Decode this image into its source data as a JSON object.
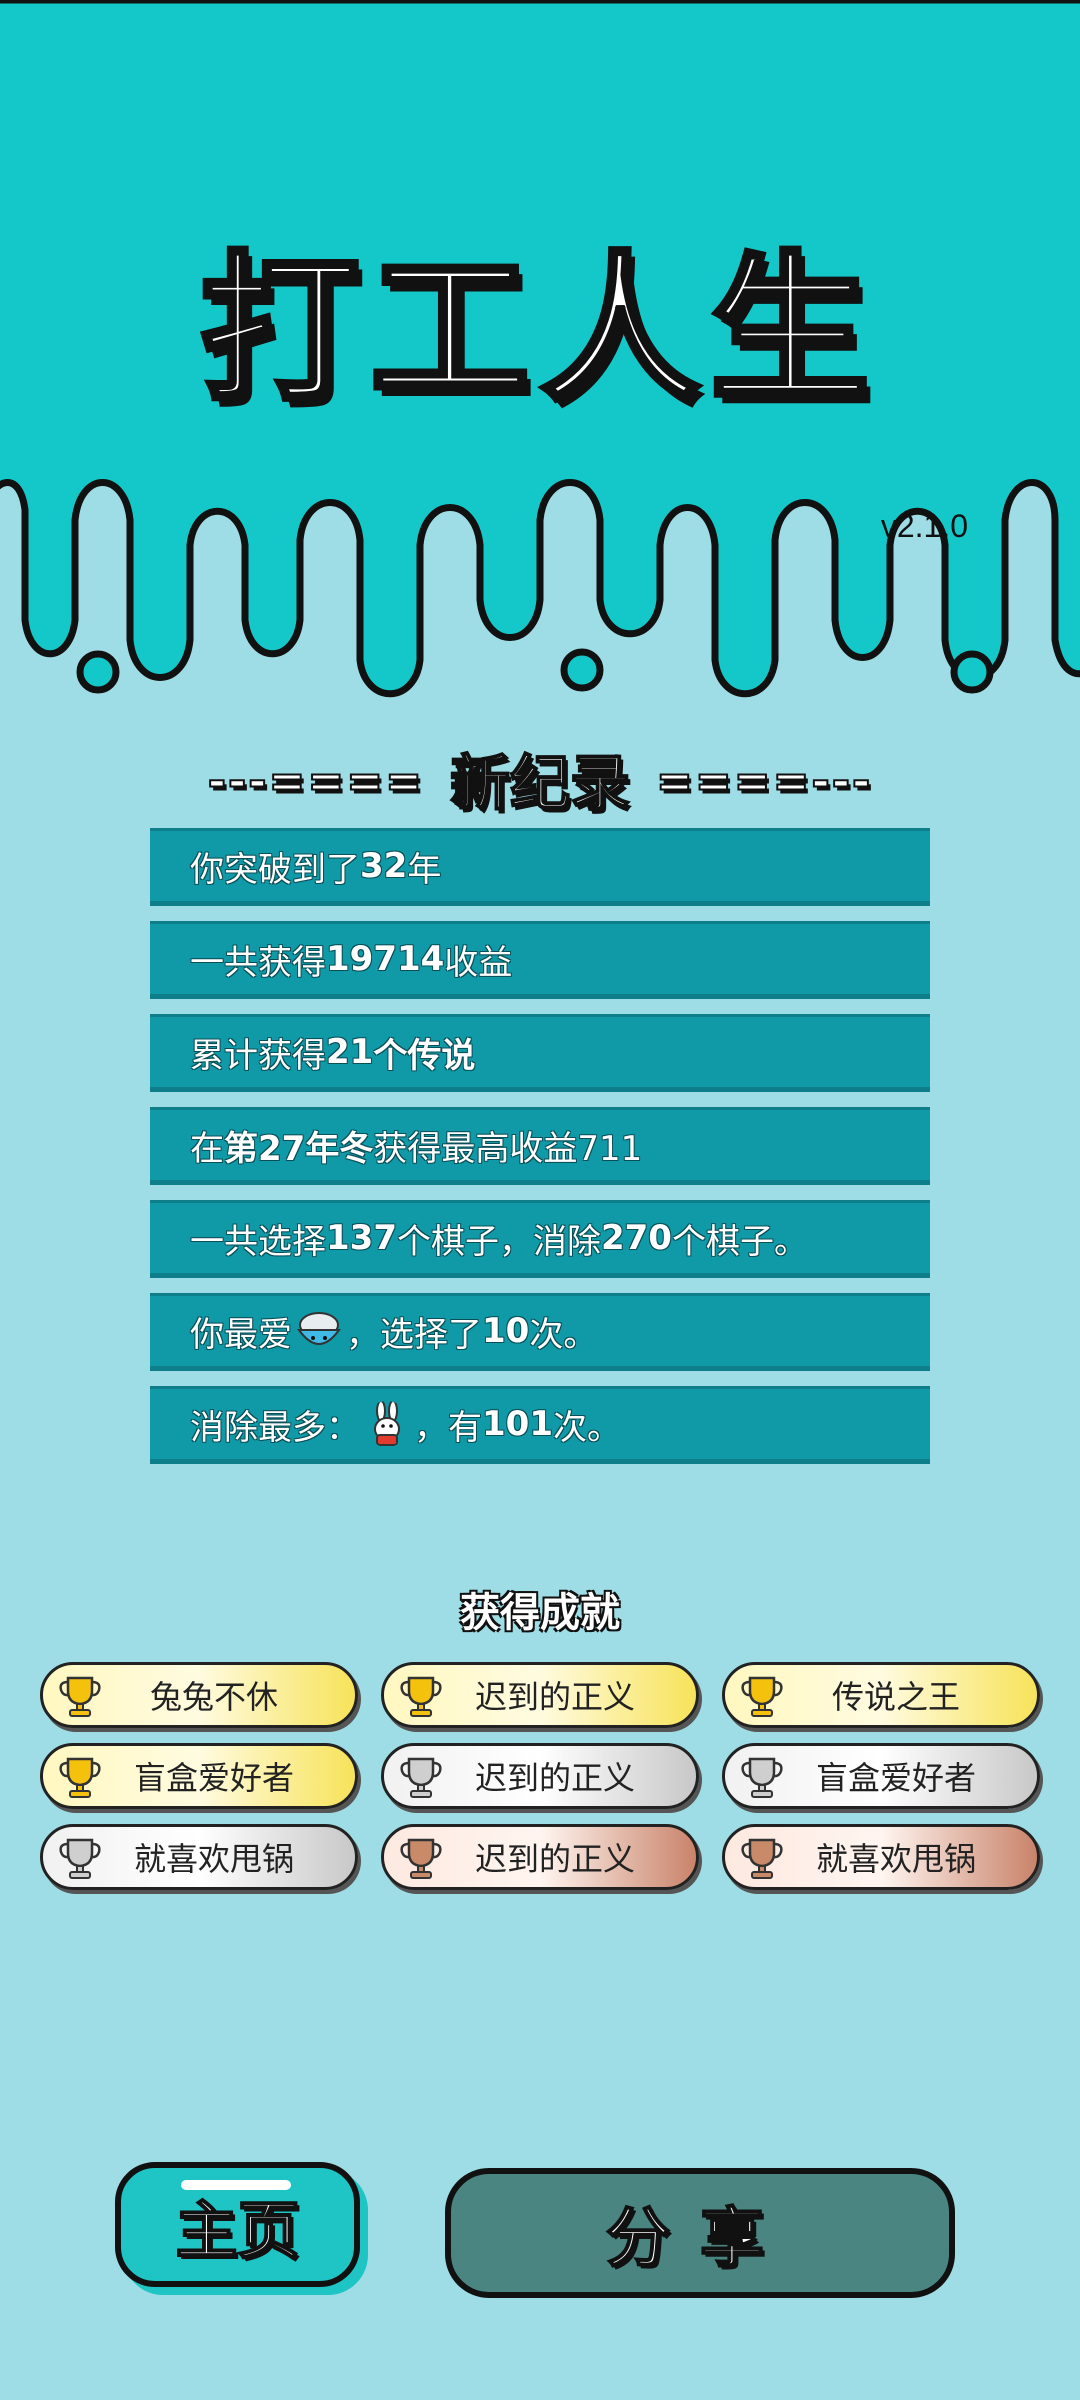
{
  "colors": {
    "header_bg": "#14c8c9",
    "body_bg": "#9fdde6",
    "record_bg": "#109aa8",
    "home_button": "#1fc4c4",
    "share_button": "#4a8582"
  },
  "header": {
    "game_title": "打工人生",
    "version": "v2.1.0"
  },
  "record": {
    "heading_left": "---====",
    "heading": "新纪录",
    "heading_right": "====---",
    "items": [
      {
        "prefix": "你突破到了",
        "value": "32",
        "suffix": "年"
      },
      {
        "prefix": "一共获得",
        "value": "19714",
        "suffix": "收益"
      },
      {
        "prefix": "累计获得",
        "value": "21",
        "suffix": "个传说"
      },
      {
        "prefix": "在 ",
        "value": "第27年冬",
        "suffix": " 获得最高收益711"
      },
      {
        "prefix": "一共选择",
        "value": "137",
        "mid": "个棋子，消除",
        "value2": "270",
        "suffix": "个棋子。"
      },
      {
        "prefix": "你最爱",
        "icon": "rice-bowl-icon",
        "mid": "，选择了",
        "value": "10",
        "suffix": "次。"
      },
      {
        "prefix": "消除最多：",
        "icon": "rabbit-icon",
        "mid": "，有",
        "value": "101",
        "suffix": "次。"
      }
    ]
  },
  "achievements": {
    "title": "获得成就",
    "items": [
      {
        "label": "兔兔不休",
        "tier": "gold"
      },
      {
        "label": "迟到的正义",
        "tier": "gold"
      },
      {
        "label": "传说之王",
        "tier": "gold"
      },
      {
        "label": "盲盒爱好者",
        "tier": "gold"
      },
      {
        "label": "迟到的正义",
        "tier": "silver"
      },
      {
        "label": "盲盒爱好者",
        "tier": "silver"
      },
      {
        "label": "就喜欢甩锅",
        "tier": "silver"
      },
      {
        "label": "迟到的正义",
        "tier": "bronze"
      },
      {
        "label": "就喜欢甩锅",
        "tier": "bronze"
      }
    ]
  },
  "buttons": {
    "home": "主页",
    "share": "分享"
  }
}
